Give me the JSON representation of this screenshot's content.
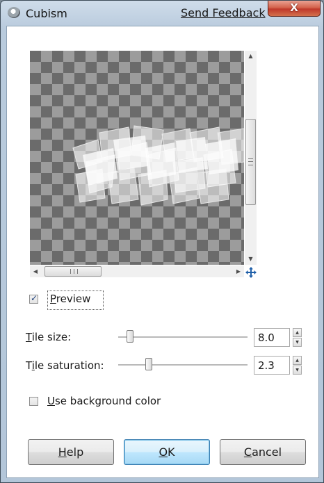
{
  "window": {
    "title": "Cubism",
    "feedback_link": "Send Feedback",
    "close_glyph": "X"
  },
  "preview": {
    "label_rest": "review",
    "label_key": "P",
    "checked": true,
    "scroll_v_arrow_up": "▲",
    "scroll_v_arrow_down": "▼",
    "scroll_h_arrow_left": "◀",
    "scroll_h_arrow_right": "▶"
  },
  "tile_size": {
    "label_key": "T",
    "label_rest": "ile size:",
    "value": "8.0"
  },
  "tile_saturation": {
    "label_key": "i",
    "label_first": "T",
    "label_rest": "le saturation:",
    "value": "2.3"
  },
  "background": {
    "label_key": "U",
    "label_rest": "se background color",
    "checked": false
  },
  "buttons": {
    "help_key": "H",
    "help_rest": "elp",
    "ok_key": "O",
    "ok_rest": "K",
    "cancel_key": "C",
    "cancel_rest": "ancel"
  },
  "icons": {
    "app": "gimp-wilber-icon",
    "navigate": "move-cross-icon",
    "spin_up": "▲",
    "spin_down": "▼"
  },
  "colors": {
    "titlebar": "#b9cbdd",
    "close_button": "#c0392b",
    "default_button": "#3c7fb1"
  }
}
